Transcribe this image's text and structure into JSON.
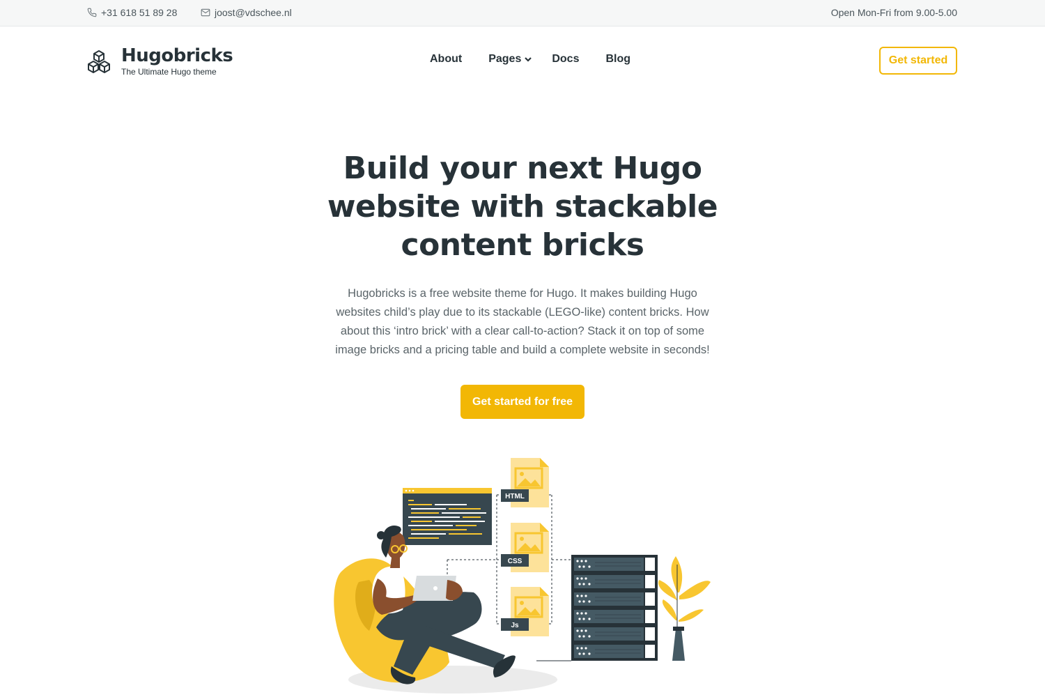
{
  "topbar": {
    "phone": "+31 618 51 89 28",
    "email": "joost@vdschee.nl",
    "hours": "Open Mon-Fri from 9.00-5.00"
  },
  "brand": {
    "name": "Hugobricks",
    "tagline": "The Ultimate Hugo theme"
  },
  "nav": {
    "items": [
      {
        "label": "About"
      },
      {
        "label": "Pages"
      },
      {
        "label": "Docs"
      },
      {
        "label": "Blog"
      }
    ],
    "cta": "Get started"
  },
  "hero": {
    "title_line1": "Build your next Hugo",
    "title_line2": "website with stackable",
    "title_line3": "content bricks",
    "description": "Hugobricks is a free website theme for Hugo. It makes building Hugo websites child’s play due to its stackable (LEGO-like) content bricks. How about this ‘intro brick’ with a clear call-to-action? Stack it on top of some image bricks and a pricing table and build a complete website in seconds!",
    "cta": "Get started for free"
  },
  "illustration": {
    "labels": [
      "HTML",
      "CSS",
      "Js"
    ]
  },
  "colors": {
    "accent": "#f2b705",
    "text": "#273238",
    "muted": "#5a6469",
    "topbar_bg": "#f6f7f7"
  }
}
